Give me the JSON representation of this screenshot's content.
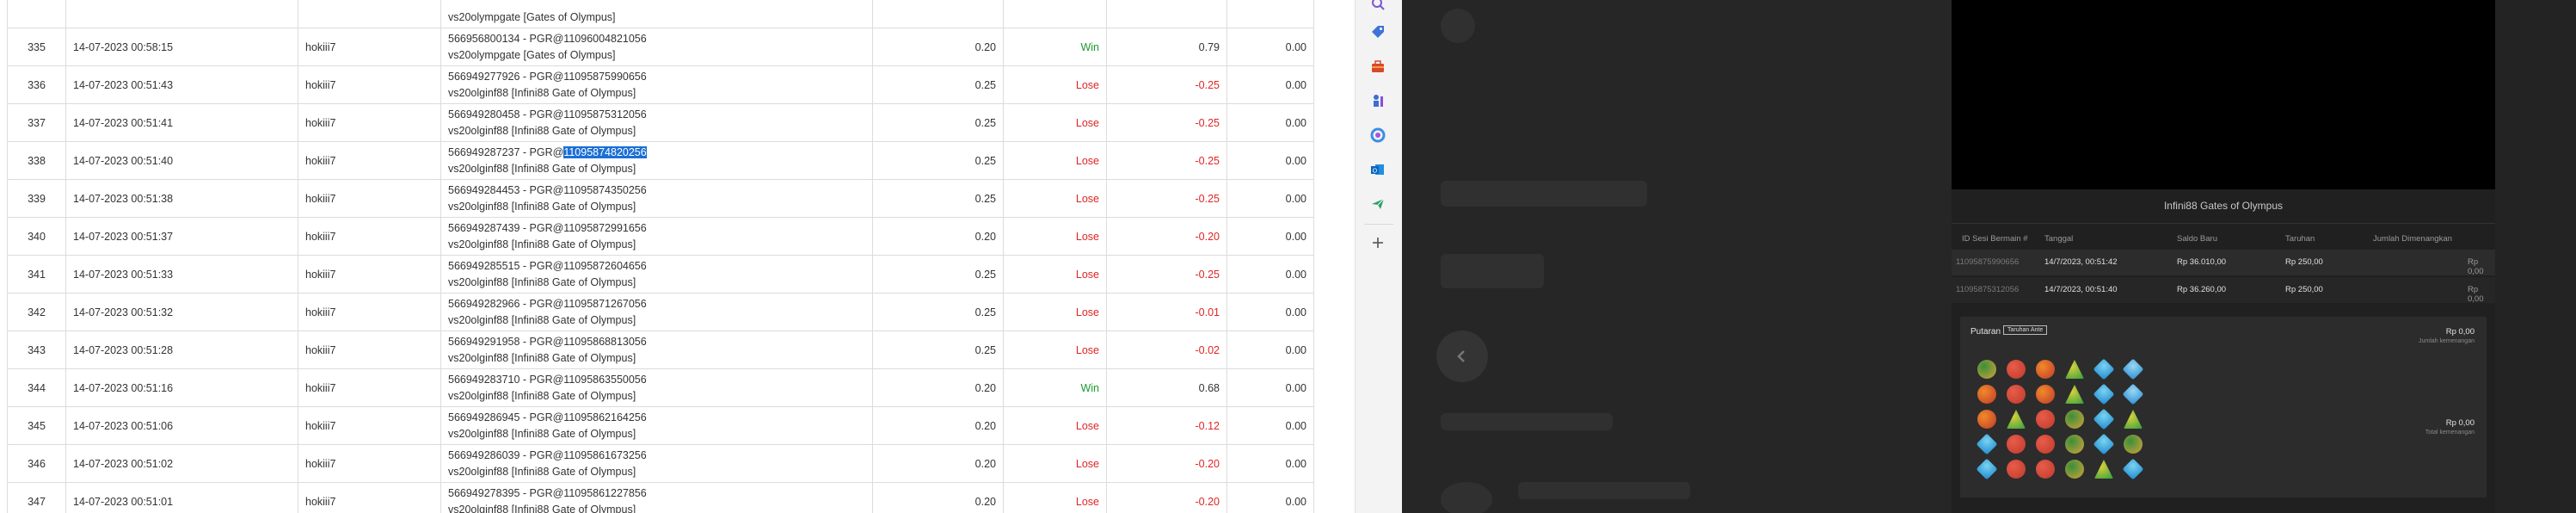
{
  "table": {
    "rows": [
      {
        "no": "335",
        "date": "14-07-2023 00:58:15",
        "user": "hokiii7",
        "detail1": "566956800134 - PGR@11096004821056",
        "detail2": "vs20olympgate [Gates of Olympus]",
        "bet": "0.20",
        "result": "Win",
        "win": "0.79",
        "balance": "0.00"
      },
      {
        "no": "336",
        "date": "14-07-2023 00:51:43",
        "user": "hokiii7",
        "detail1": "566949277926 - PGR@11095875990656",
        "detail2": "vs20olginf88 [Infini88 Gate of Olympus]",
        "bet": "0.25",
        "result": "Lose",
        "win": "-0.25",
        "balance": "0.00"
      },
      {
        "no": "337",
        "date": "14-07-2023 00:51:41",
        "user": "hokiii7",
        "detail1": "566949280458 - PGR@11095875312056",
        "detail2": "vs20olginf88 [Infini88 Gate of Olympus]",
        "bet": "0.25",
        "result": "Lose",
        "win": "-0.25",
        "balance": "0.00"
      },
      {
        "no": "338",
        "date": "14-07-2023 00:51:40",
        "user": "hokiii7",
        "detail1_pre": "566949287237 - PGR@",
        "detail1_sel": "11095874820256",
        "detail2": "vs20olginf88 [Infini88 Gate of Olympus]",
        "bet": "0.25",
        "result": "Lose",
        "win": "-0.25",
        "balance": "0.00"
      },
      {
        "no": "339",
        "date": "14-07-2023 00:51:38",
        "user": "hokiii7",
        "detail1": "566949284453 - PGR@11095874350256",
        "detail2": "vs20olginf88 [Infini88 Gate of Olympus]",
        "bet": "0.25",
        "result": "Lose",
        "win": "-0.25",
        "balance": "0.00"
      },
      {
        "no": "340",
        "date": "14-07-2023 00:51:37",
        "user": "hokiii7",
        "detail1": "566949287439 - PGR@11095872991656",
        "detail2": "vs20olginf88 [Infini88 Gate of Olympus]",
        "bet": "0.20",
        "result": "Lose",
        "win": "-0.20",
        "balance": "0.00"
      },
      {
        "no": "341",
        "date": "14-07-2023 00:51:33",
        "user": "hokiii7",
        "detail1": "566949285515 - PGR@11095872604656",
        "detail2": "vs20olginf88 [Infini88 Gate of Olympus]",
        "bet": "0.25",
        "result": "Lose",
        "win": "-0.25",
        "balance": "0.00"
      },
      {
        "no": "342",
        "date": "14-07-2023 00:51:32",
        "user": "hokiii7",
        "detail1": "566949282966 - PGR@11095871267056",
        "detail2": "vs20olginf88 [Infini88 Gate of Olympus]",
        "bet": "0.25",
        "result": "Lose",
        "win": "-0.01",
        "balance": "0.00"
      },
      {
        "no": "343",
        "date": "14-07-2023 00:51:28",
        "user": "hokiii7",
        "detail1": "566949291958 - PGR@11095868813056",
        "detail2": "vs20olginf88 [Infini88 Gate of Olympus]",
        "bet": "0.25",
        "result": "Lose",
        "win": "-0.02",
        "balance": "0.00"
      },
      {
        "no": "344",
        "date": "14-07-2023 00:51:16",
        "user": "hokiii7",
        "detail1": "566949283710 - PGR@11095863550056",
        "detail2": "vs20olginf88 [Infini88 Gate of Olympus]",
        "bet": "0.20",
        "result": "Win",
        "win": "0.68",
        "balance": "0.00"
      },
      {
        "no": "345",
        "date": "14-07-2023 00:51:06",
        "user": "hokiii7",
        "detail1": "566949286945 - PGR@11095862164256",
        "detail2": "vs20olginf88 [Infini88 Gate of Olympus]",
        "bet": "0.20",
        "result": "Lose",
        "win": "-0.12",
        "balance": "0.00"
      },
      {
        "no": "346",
        "date": "14-07-2023 00:51:02",
        "user": "hokiii7",
        "detail1": "566949286039 - PGR@11095861673256",
        "detail2": "vs20olginf88 [Infini88 Gate of Olympus]",
        "bet": "0.20",
        "result": "Lose",
        "win": "-0.20",
        "balance": "0.00"
      },
      {
        "no": "347",
        "date": "14-07-2023 00:51:01",
        "user": "hokiii7",
        "detail1": "566949278395 - PGR@11095861227856",
        "detail2": "vs20olginf88 [Infini88 Gate of Olympus]",
        "bet": "0.20",
        "result": "Lose",
        "win": "-0.20",
        "balance": "0.00"
      }
    ],
    "top_partial": "vs20olympgate [Gates of Olympus]"
  },
  "sidebar": {
    "icons": [
      "search-icon",
      "tag-icon",
      "toolbox-icon",
      "chess-icon",
      "office-icon",
      "outlook-icon",
      "send-icon",
      "add-icon"
    ]
  },
  "game": {
    "title": "Infini88 Gates of Olympus",
    "columns": [
      "ID Sesi Bermain #",
      "Tanggal",
      "Saldo Baru",
      "Taruhan",
      "Jumlah Dimenangkan"
    ],
    "rows": [
      {
        "id": "11095875990656",
        "date": "14/7/2023, 00:51:42",
        "saldo": "Rp 36.010,00",
        "taruhan": "Rp 250,00",
        "win": "Rp 0,00"
      },
      {
        "id": "11095875312056",
        "date": "14/7/2023, 00:51:40",
        "saldo": "Rp 36.260,00",
        "taruhan": "Rp 250,00",
        "win": "Rp 0,00"
      }
    ],
    "spin_label": "Putaran",
    "feature_label": "Taruhan Ante",
    "spin_win": "Rp 0,00",
    "spin_win_sub": "Jumlah kemenangan",
    "total_win": "Rp 0,00",
    "total_win_sub": "Total kemenangan"
  },
  "colors": {
    "win": "#1e9a2e",
    "lose": "#e02424",
    "selection": "#1a6fd6"
  }
}
